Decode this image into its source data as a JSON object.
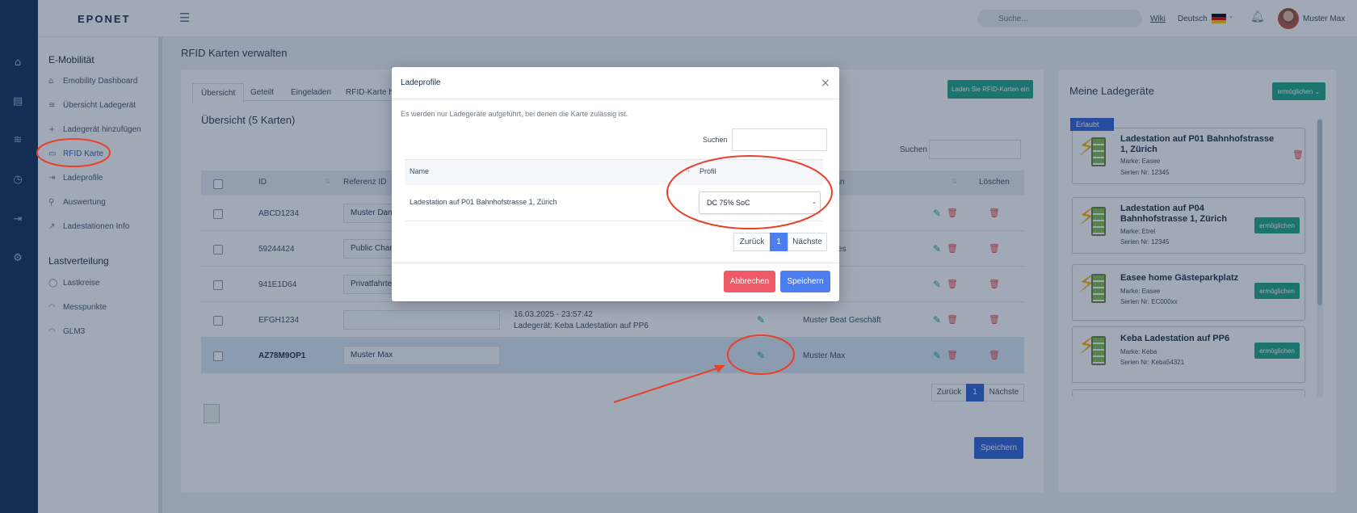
{
  "topbar": {
    "logo": "EPONET",
    "search_placeholder": "Suche...",
    "wiki": "Wiki",
    "language": "Deutsch",
    "user": "Muster Max"
  },
  "rail_icons": [
    "home-icon",
    "calendar-icon",
    "waves-icon",
    "clock-icon",
    "login-icon",
    "gear-icon"
  ],
  "sidebar": {
    "section1": "E-Mobilität",
    "items1": [
      {
        "label": "Emobility Dashboard",
        "icon": "⌂"
      },
      {
        "label": "Übersicht Ladegerät",
        "icon": "≋"
      },
      {
        "label": "Ladegerät hinzufügen",
        "icon": "+"
      },
      {
        "label": "RFID Karte",
        "icon": "▭"
      },
      {
        "label": "Ladeprofile",
        "icon": "⇥"
      },
      {
        "label": "Auswertung",
        "icon": "⚲"
      },
      {
        "label": "Ladestationen Info",
        "icon": "↗"
      }
    ],
    "section2": "Lastverteilung",
    "items2": [
      {
        "label": "Lastkreise",
        "icon": "◯"
      },
      {
        "label": "Messpunkte",
        "icon": "◠"
      },
      {
        "label": "GLM3",
        "icon": "◠"
      }
    ]
  },
  "main": {
    "page_title": "RFID Karten verwalten",
    "tabs": [
      "Übersicht",
      "Geteilt",
      "Eingeladen",
      "RFID-Karte hi"
    ],
    "upload_button": "Laden Sie RFID-Karten ein",
    "overview_title": "Übersicht (5 Karten)",
    "search_label": "Suchen",
    "columns": {
      "id": "ID",
      "ref": "Referenz ID",
      "assigned": "n an",
      "delete": "Löschen"
    },
    "rows": [
      {
        "id": "ABCD1234",
        "ref": "Muster Danie",
        "last_line1": "",
        "last_line2": "",
        "assigned": "iel"
      },
      {
        "id": "59244424",
        "ref": "Public Charg",
        "last_line1": "",
        "last_line2": "",
        "assigned": "erles"
      },
      {
        "id": "941E1D64",
        "ref": "Privatfahrten",
        "last_line1": "",
        "last_line2": "",
        "assigned": "t"
      },
      {
        "id": "EFGH1234",
        "ref": "",
        "last_line1": "16.03.2025 - 23:57:42",
        "last_line2": "Ladegerät: Keba Ladestation auf PP6",
        "assigned": "Muster Beat Geschäft"
      },
      {
        "id": "AZ78M9OP1",
        "ref": "Muster Max",
        "last_line1": "",
        "last_line2": "",
        "assigned": "Muster Max"
      }
    ],
    "pagination": {
      "prev": "Zurück",
      "page": "1",
      "next": "Nächste"
    },
    "save_button": "Speichern"
  },
  "right": {
    "title": "Meine Ladegeräte",
    "button": "ermöglichen ⌄",
    "badge": "Erlaubt",
    "chargers": [
      {
        "name": "Ladestation auf P01 Bahnhofstrasse 1, Zürich",
        "brand": "Marke: Easee",
        "serial": "Serien Nr: 12345",
        "action": ""
      },
      {
        "name": "Ladestation auf P04 Bahnhofstrasse 1, Zürich",
        "brand": "Marke: Etrel",
        "serial": "Serien Nr: 12345",
        "action": "ermöglichen"
      },
      {
        "name": "Easee home Gästeparkplatz",
        "brand": "Marke: Easee",
        "serial": "Serien Nr: EC000xx",
        "action": "ermöglichen"
      },
      {
        "name": "Keba Ladestation auf PP6",
        "brand": "Marke: Keba",
        "serial": "Serien Nr: Keba54321",
        "action": "ermöglichen"
      }
    ]
  },
  "modal": {
    "title": "Ladeprofile",
    "close": "×",
    "note": "Es werden nur Ladegeräte aufgeführt, bei denen die Karte zulässig ist.",
    "search_label": "Suchen",
    "col_name": "Name",
    "col_profile": "Profil",
    "row_name": "Ladestation auf P01 Bahnhofstrasse 1, Zürich",
    "row_profile": "DC 75% SoC",
    "pagination": {
      "prev": "Zurück",
      "page": "1",
      "next": "Nächste"
    },
    "cancel": "Abbrechen",
    "save": "Speichern"
  },
  "colors": {
    "accent": "#19a584",
    "primary": "#2b5fd8",
    "danger": "#ef5a67",
    "annotation": "#e8402a"
  }
}
